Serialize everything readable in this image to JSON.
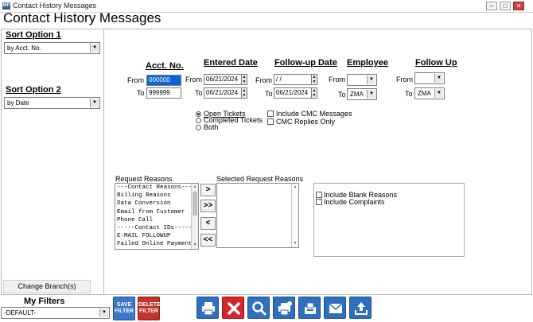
{
  "window": {
    "title": "Contact History Messages",
    "app_icon": "MP"
  },
  "page_title": "Contact History Messages",
  "left": {
    "sort1": {
      "label": "Sort Option 1",
      "value": "by Acct. No."
    },
    "sort2": {
      "label": "Sort Option 2",
      "value": "by Date"
    },
    "change_branch": "Change Branch(s)"
  },
  "criteria": {
    "acct_header": "Acct. No.",
    "entered_header": "Entered Date",
    "followup_date_header": "Follow-up Date",
    "employee_header": "Employee",
    "followup_header": "Follow Up",
    "from_label": "From",
    "to_label": "To",
    "acct_from": "000000",
    "acct_to": "999999",
    "entered_from": "06/21/2024",
    "entered_to": "06/21/2024",
    "followup_from": " / /",
    "followup_to": "06/21/2024",
    "employee_from": "",
    "employee_to": "ZMA",
    "followup_from_val": "",
    "followup_to_val": "ZMA"
  },
  "tickets": {
    "open": "Open Tickets",
    "completed": "Completed Tickets",
    "both": "Both",
    "selected": "open"
  },
  "options": {
    "include_cmc": "Include CMC Messages",
    "cmc_replies": "CMC Replies Only",
    "include_blank": "Include Blank Reasons",
    "include_complaints": "Include Complaints"
  },
  "reasons": {
    "label": "Request Reasons",
    "selected_label": "Selected Request Reasons",
    "items": [
      "---Contact Reasons---",
      "Billing Reasons",
      "Data Conversion",
      "Email from Customer",
      "Phone Call",
      "-----Contact IDs-----",
      "E-MAIL FOLLOWUP",
      "Failed Online Payment"
    ],
    "btn_add": ">",
    "btn_add_all": ">>",
    "btn_remove": "<",
    "btn_remove_all": "<<"
  },
  "filters": {
    "label": "My Filters",
    "value": "-DEFAULT-",
    "save_label": "SAVE FILTER",
    "delete_label": "DELETE FILTER"
  },
  "colors": {
    "accent": "#2f6fbd",
    "save": "#3b78c8",
    "delete": "#c0342c",
    "close": "#d8252b"
  }
}
